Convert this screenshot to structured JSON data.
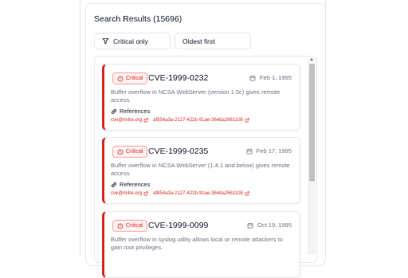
{
  "results": {
    "title": "Search Results (15696)"
  },
  "filters": {
    "severity_label": "Critical only",
    "sort_label": "Oldest first"
  },
  "cves": [
    {
      "severity": "Critical",
      "id": "CVE-1999-0232",
      "date": "Feb 1, 1995",
      "description_line1": "Buffer overflow in NCSA WebServer (version 1.5c) gives remote",
      "description_line2": "access.",
      "references_label": "References",
      "ref1": "cve@mitre.org",
      "ref2": "af854a3a-2127-422b-91ae-364da2661108"
    },
    {
      "severity": "Critical",
      "id": "CVE-1999-0235",
      "date": "Feb 17, 1995",
      "description_line1": "Buffer overflow in NCSA WebServer (1.4.1 and below) gives remote",
      "description_line2": "access.",
      "references_label": "References",
      "ref1": "cve@mitre.org",
      "ref2": "af854a3a-2127-422b-91ae-364da2661108"
    },
    {
      "severity": "Critical",
      "id": "CVE-1999-0099",
      "date": "Oct 19, 1995",
      "description_line1": "Buffer overflow in syslog utility allows local or remote attackers to",
      "description_line2": "gain root privileges.",
      "references_label": "",
      "ref1": "",
      "ref2": ""
    }
  ],
  "colors": {
    "critical": "#dc2626",
    "border": "#e5e7eb",
    "muted": "#6b7280"
  },
  "icons": {
    "filter": "filter-icon",
    "alert": "alert-circle-icon",
    "calendar": "calendar-icon",
    "link": "link-icon",
    "external": "external-link-icon"
  }
}
